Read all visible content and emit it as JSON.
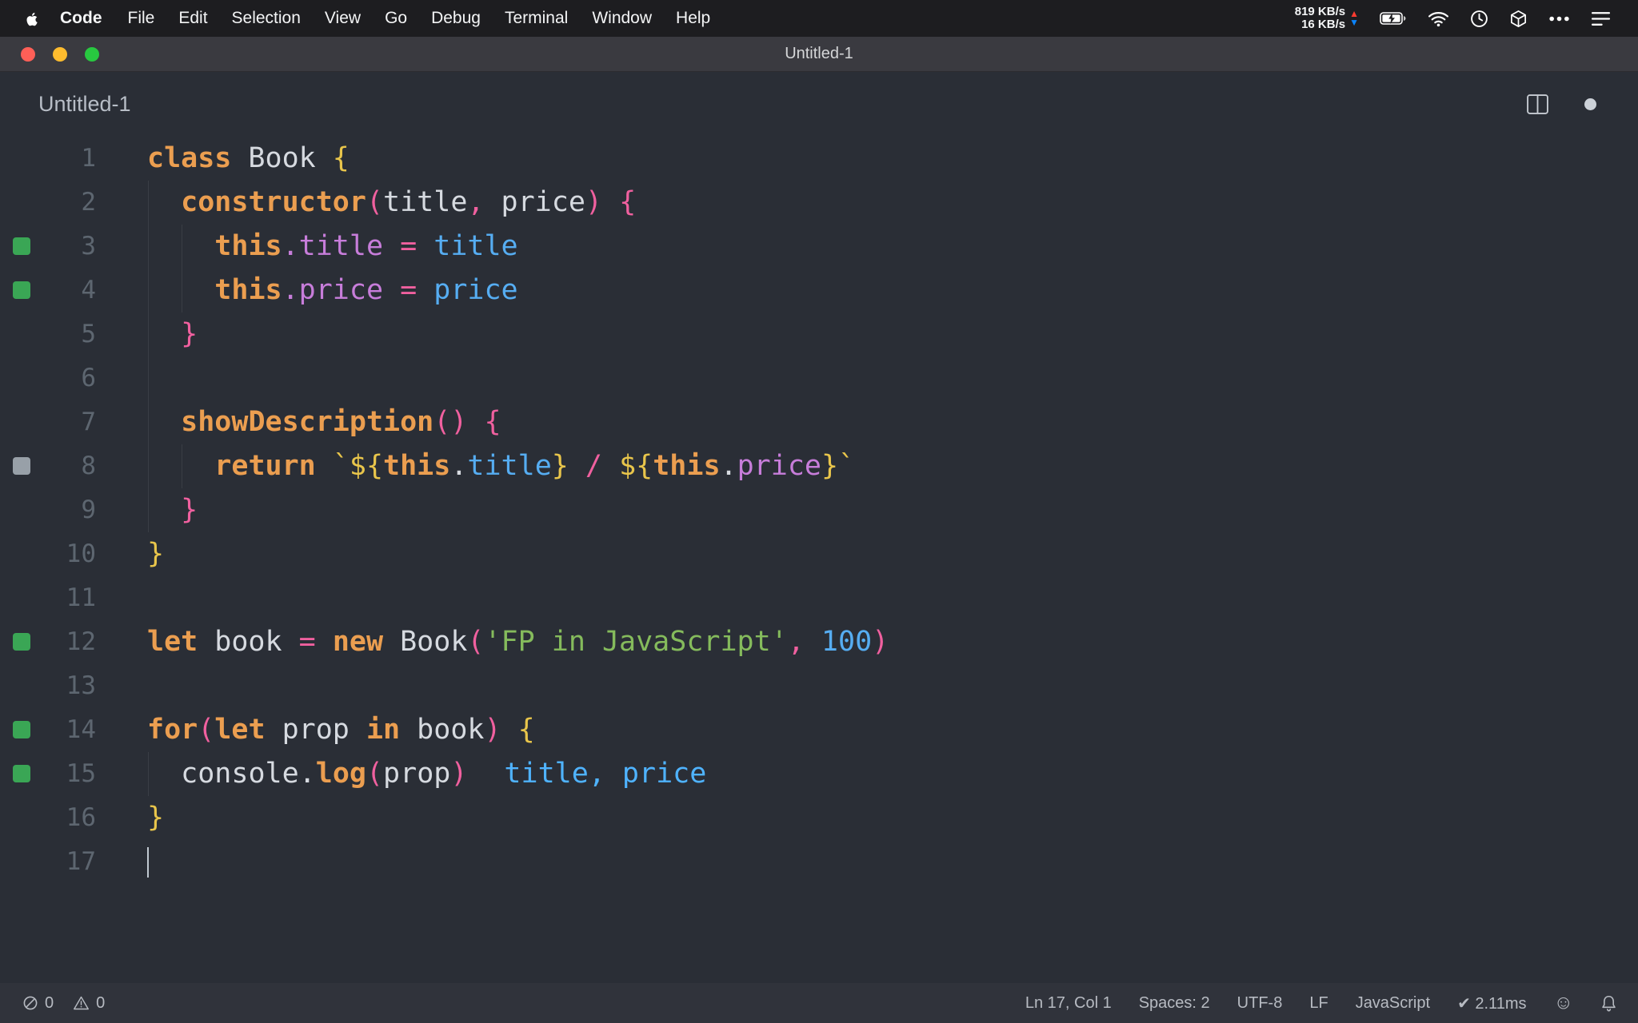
{
  "theme": {
    "bg": "#2a2e36",
    "menubar_bg": "#1d1d20",
    "titlebar_bg": "#3a3a40",
    "statusbar_bg": "#30333b",
    "kw": "#eb9e50",
    "id": "#d6dae0",
    "pu": "#c77dda",
    "p": "#f0609f",
    "val": "#56adf2",
    "str": "#85bb5c",
    "y": "#e8c54b",
    "ann": "#4fb3ff",
    "green_indicator": "#3aa655",
    "gray_indicator": "#98a0a8",
    "line_number": "#5d6670"
  },
  "menubar": {
    "app_name": "Code",
    "items": [
      "File",
      "Edit",
      "Selection",
      "View",
      "Go",
      "Debug",
      "Terminal",
      "Window",
      "Help"
    ],
    "network_up": "819 KB/s",
    "network_down": "16 KB/s",
    "up_arrow": "▲",
    "down_arrow": "▼",
    "status_icons": [
      "battery-charging-icon",
      "wifi-icon",
      "clock-icon",
      "cube-icon",
      "ellipsis-icon",
      "list-icon"
    ]
  },
  "window": {
    "title": "Untitled-1"
  },
  "editor": {
    "tab_label": "Untitled-1",
    "lines": [
      {
        "n": 1,
        "g": null,
        "guides": 0,
        "t": [
          [
            "class",
            "kw"
          ],
          [
            " Book ",
            "id"
          ],
          [
            "{",
            "y"
          ]
        ]
      },
      {
        "n": 2,
        "g": null,
        "guides": 1,
        "t": [
          [
            "  ",
            "id"
          ],
          [
            "constructor",
            "kw"
          ],
          [
            "(",
            "p"
          ],
          [
            "title",
            "id"
          ],
          [
            ",",
            "p"
          ],
          [
            " price",
            "id"
          ],
          [
            ")",
            "p"
          ],
          [
            " ",
            "id"
          ],
          [
            "{",
            "p"
          ]
        ]
      },
      {
        "n": 3,
        "g": "green",
        "guides": 2,
        "t": [
          [
            "    ",
            "id"
          ],
          [
            "this",
            "kw"
          ],
          [
            ".title",
            "pu"
          ],
          [
            " ",
            "id"
          ],
          [
            "=",
            "p"
          ],
          [
            " ",
            "id"
          ],
          [
            "title",
            "val"
          ]
        ]
      },
      {
        "n": 4,
        "g": "green",
        "guides": 2,
        "t": [
          [
            "    ",
            "id"
          ],
          [
            "this",
            "kw"
          ],
          [
            ".price",
            "pu"
          ],
          [
            " ",
            "id"
          ],
          [
            "=",
            "p"
          ],
          [
            " ",
            "id"
          ],
          [
            "price",
            "val"
          ]
        ]
      },
      {
        "n": 5,
        "g": null,
        "guides": 1,
        "t": [
          [
            "  ",
            "id"
          ],
          [
            "}",
            "p"
          ]
        ]
      },
      {
        "n": 6,
        "g": null,
        "guides": 1,
        "t": []
      },
      {
        "n": 7,
        "g": null,
        "guides": 1,
        "t": [
          [
            "  ",
            "id"
          ],
          [
            "showDescription",
            "kw"
          ],
          [
            "()",
            "p"
          ],
          [
            " ",
            "id"
          ],
          [
            "{",
            "p"
          ]
        ]
      },
      {
        "n": 8,
        "g": "gray",
        "guides": 2,
        "t": [
          [
            "    ",
            "id"
          ],
          [
            "return",
            "kw"
          ],
          [
            " ",
            "id"
          ],
          [
            "`${",
            "y"
          ],
          [
            "this",
            "kw"
          ],
          [
            ".",
            "id"
          ],
          [
            "title",
            "val"
          ],
          [
            "}",
            "y"
          ],
          [
            " ",
            "id"
          ],
          [
            "/",
            "p"
          ],
          [
            " ",
            "id"
          ],
          [
            "${",
            "y"
          ],
          [
            "this",
            "kw"
          ],
          [
            ".",
            "id"
          ],
          [
            "price",
            "pu"
          ],
          [
            "}`",
            "y"
          ]
        ]
      },
      {
        "n": 9,
        "g": null,
        "guides": 1,
        "t": [
          [
            "  ",
            "id"
          ],
          [
            "}",
            "p"
          ]
        ]
      },
      {
        "n": 10,
        "g": null,
        "guides": 0,
        "t": [
          [
            "}",
            "y"
          ]
        ]
      },
      {
        "n": 11,
        "g": null,
        "guides": 0,
        "t": []
      },
      {
        "n": 12,
        "g": "green",
        "guides": 0,
        "t": [
          [
            "let",
            "kw"
          ],
          [
            " book ",
            "id"
          ],
          [
            "=",
            "p"
          ],
          [
            " ",
            "id"
          ],
          [
            "new",
            "kw"
          ],
          [
            " Book",
            "id"
          ],
          [
            "(",
            "p"
          ],
          [
            "'FP in JavaScript'",
            "str"
          ],
          [
            ",",
            "p"
          ],
          [
            " ",
            "id"
          ],
          [
            "100",
            "val"
          ],
          [
            ")",
            "p"
          ]
        ]
      },
      {
        "n": 13,
        "g": null,
        "guides": 0,
        "t": []
      },
      {
        "n": 14,
        "g": "green",
        "guides": 0,
        "t": [
          [
            "for",
            "kw"
          ],
          [
            "(",
            "p"
          ],
          [
            "let",
            "kw"
          ],
          [
            " prop ",
            "id"
          ],
          [
            "in",
            "kw"
          ],
          [
            " book",
            "id"
          ],
          [
            ")",
            "p"
          ],
          [
            " ",
            "id"
          ],
          [
            "{",
            "y"
          ]
        ]
      },
      {
        "n": 15,
        "g": "green",
        "guides": 1,
        "t": [
          [
            "  ",
            "id"
          ],
          [
            "console",
            "id"
          ],
          [
            ".",
            "id"
          ],
          [
            "log",
            "kw"
          ],
          [
            "(",
            "p"
          ],
          [
            "prop",
            "id"
          ],
          [
            ")",
            "p"
          ]
        ],
        "ann": "title, price"
      },
      {
        "n": 16,
        "g": null,
        "guides": 0,
        "t": [
          [
            "}",
            "y"
          ]
        ]
      },
      {
        "n": 17,
        "g": null,
        "guides": 0,
        "t": [],
        "cursor": true
      }
    ]
  },
  "statusbar": {
    "errors": "0",
    "warnings": "0",
    "cursor_position": "Ln 17, Col 1",
    "indentation": "Spaces: 2",
    "encoding": "UTF-8",
    "eol": "LF",
    "language": "JavaScript",
    "quokka_time": "✔ 2.11ms",
    "smiley": "☺",
    "icons": [
      "error-icon",
      "warning-icon",
      "smiley-icon",
      "bell-icon"
    ]
  }
}
